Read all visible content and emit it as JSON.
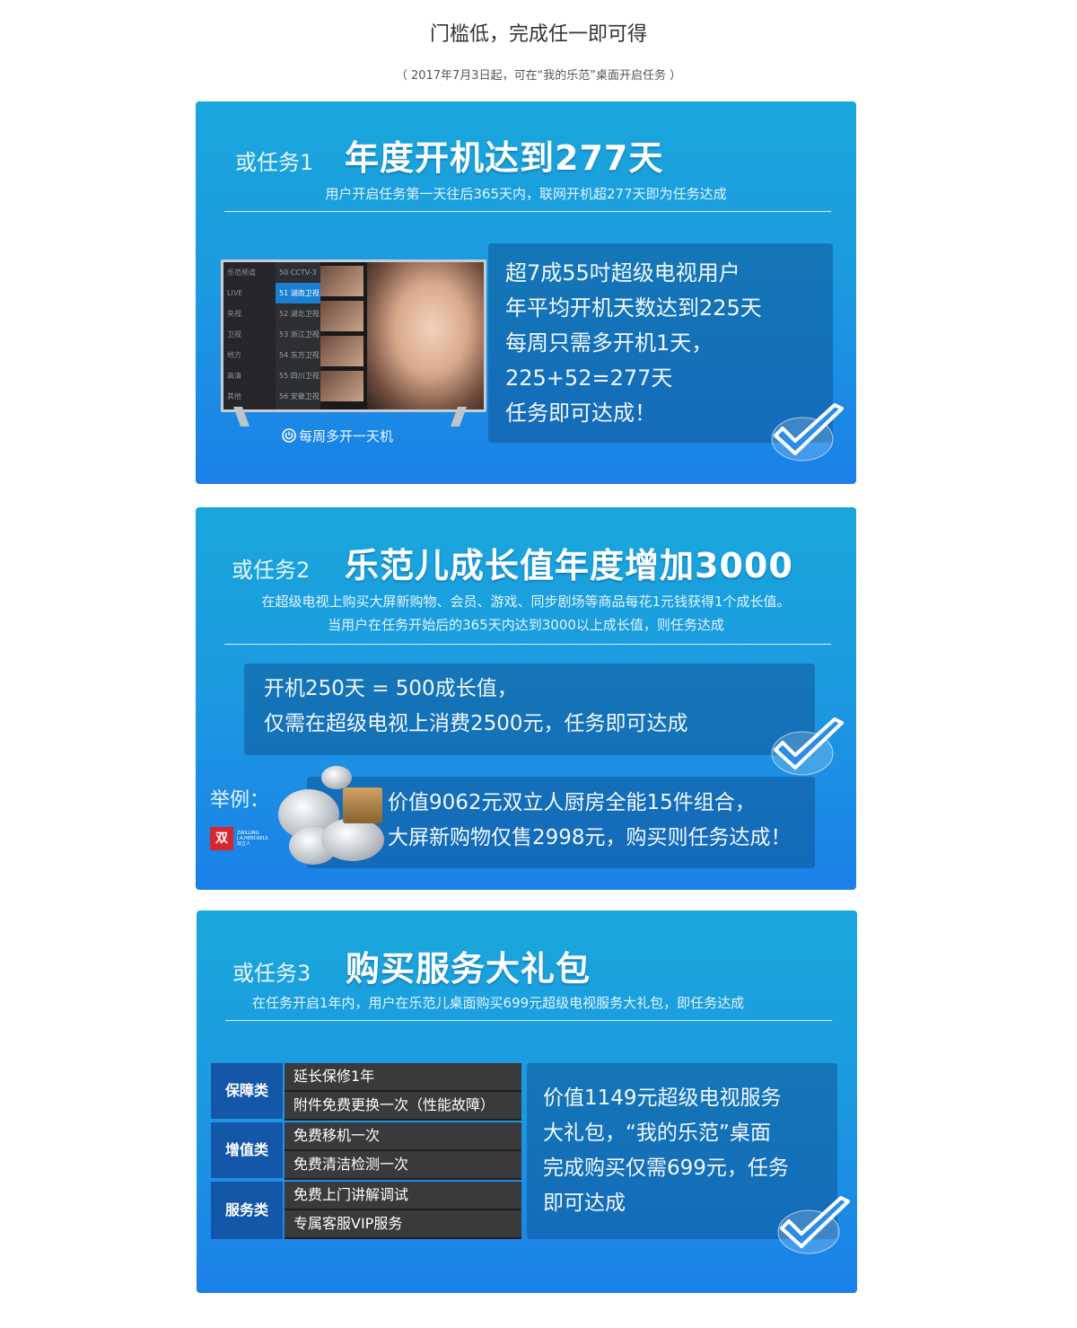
{
  "header": {
    "title": "门槛低，完成任一即可得",
    "subtitle": "（ 2017年7月3日起，可在“我的乐范”桌面开启任务 ）"
  },
  "task1": {
    "tag": "或任务1",
    "headline": "年度开机达到277天",
    "desc": "用户开启任务第一天往后365天内，联网开机超277天即为任务达成",
    "tv": {
      "menu": [
        "乐范频道",
        "LIVE",
        "央视",
        "卫视",
        "地方",
        "高清",
        "其他"
      ],
      "channels": [
        "50 CCTV-3",
        "51 湖南卫视",
        "52 湖北卫视",
        "53 浙江卫视",
        "54 东方卫视",
        "55 四川卫视",
        "56 安徽卫视"
      ],
      "caption": "每周多开一天机"
    },
    "panel_lines": [
      "超7成55吋超级电视用户",
      "年平均开机天数达到225天",
      "每周只需多开机1天，",
      "225+52=277天",
      "任务即可达成！"
    ]
  },
  "task2": {
    "tag": "或任务2",
    "headline": "乐范儿成长值年度增加3000",
    "desc_lines": [
      "在超级电视上购买大屏新购物、会员、游戏、同步剧场等商品每花1元钱获得1个成长值。",
      "当用户在任务开始后的365天内达到3000以上成长值，则任务达成"
    ],
    "panel_lines": [
      "开机250天 = 500成长值，",
      "仅需在超级电视上消费2500元，任务即可达成"
    ],
    "example_label": "举例：",
    "brand_text": "ZWILLING J.A.HENCKELS 双立人",
    "example_lines": [
      "价值9062元双立人厨房全能15件组合，",
      "大屏新购物仅售2998元，购买则任务达成！"
    ]
  },
  "task3": {
    "tag": "或任务3",
    "headline": "购买服务大礼包",
    "desc": "在任务开启1年内，用户在乐范儿桌面购买699元超级电视服务大礼包，即任务达成",
    "categories": [
      {
        "name": "保障类",
        "items": [
          "延长保修1年",
          "附件免费更换一次（性能故障）"
        ]
      },
      {
        "name": "增值类",
        "items": [
          "免费移机一次",
          "免费清洁检测一次"
        ]
      },
      {
        "name": "服务类",
        "items": [
          "免费上门讲解调试",
          "专属客服VIP服务"
        ]
      }
    ],
    "panel_lines": [
      "价值1149元超级电视服务",
      "大礼包，“我的乐范”桌面",
      "完成购买仅需699元，任务",
      "即可达成"
    ]
  },
  "colors": {
    "card_top": "#19a6db",
    "card_bottom": "#1b80e8",
    "check": "#2b8de8"
  },
  "icons": {
    "check": "checkmark-icon",
    "power": "power-icon"
  }
}
